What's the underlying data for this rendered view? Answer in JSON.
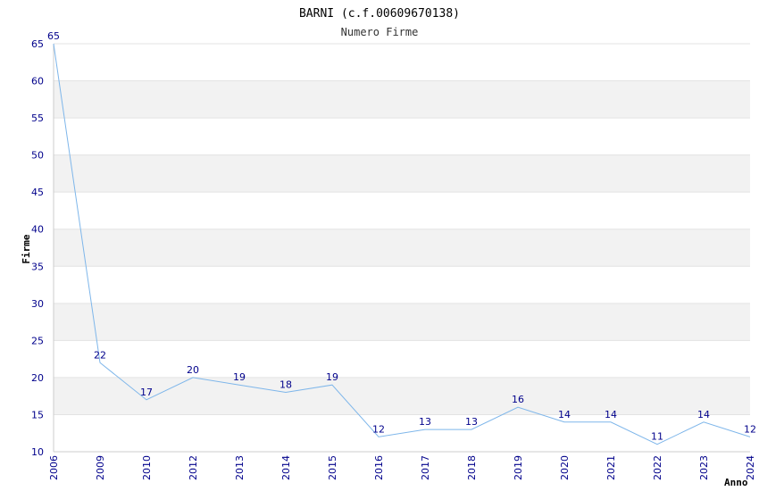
{
  "chart_data": {
    "type": "line",
    "title": "BARNI (c.f.00609670138)",
    "subtitle": "Numero Firme",
    "xlabel": "Anno",
    "ylabel": "Firme",
    "categories": [
      "2006",
      "2009",
      "2010",
      "2012",
      "2013",
      "2014",
      "2015",
      "2016",
      "2017",
      "2018",
      "2019",
      "2020",
      "2021",
      "2022",
      "2023",
      "2024"
    ],
    "series": [
      {
        "values": [
          65,
          22,
          17,
          20,
          19,
          18,
          19,
          12,
          13,
          13,
          16,
          14,
          14,
          11,
          14,
          12
        ]
      }
    ],
    "ylim": [
      10,
      65
    ],
    "yticks": [
      10,
      15,
      20,
      25,
      30,
      35,
      40,
      45,
      50,
      55,
      60,
      65
    ],
    "grid": "horizontal alternating bands",
    "line_color": "#7eb6ea",
    "band_color": "#f2f2f2",
    "tick_color": "#00008b"
  }
}
